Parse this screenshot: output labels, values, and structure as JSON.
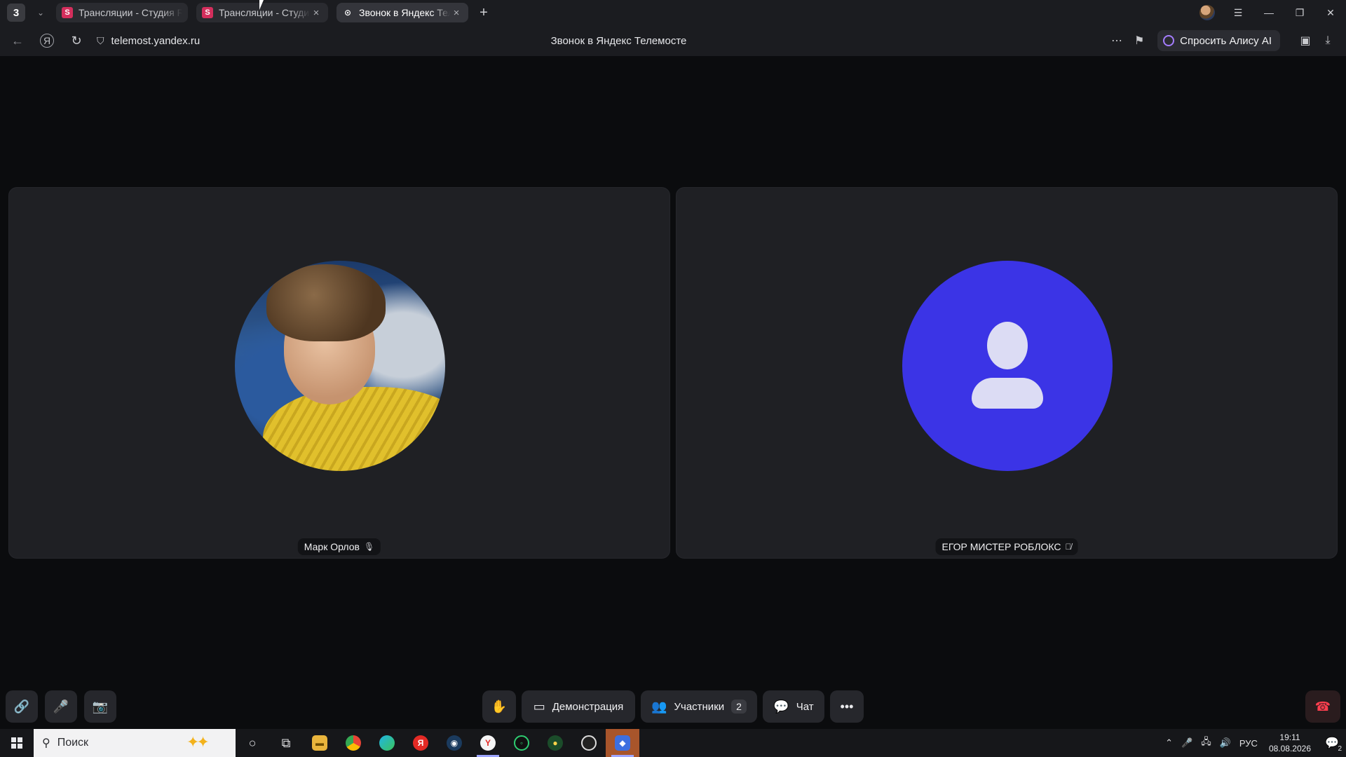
{
  "browser": {
    "tab_count": "3",
    "tabs": [
      {
        "title": "Трансляции - Студия RUTUBE",
        "favicon": "S",
        "state": "inactive"
      },
      {
        "title": "Трансляции - Студия RUTUBE",
        "favicon": "S",
        "state": "hovered"
      },
      {
        "title": "Звонок в Яндекс Телемосте",
        "favicon": "telemost-icon",
        "state": "active"
      }
    ],
    "url": "telemost.yandex.ru",
    "page_title": "Звонок в Яндекс Телемосте",
    "alice_button": "Спросить Алису AI"
  },
  "call": {
    "participants": [
      {
        "name": "Марк Орлов",
        "avatar": "photo",
        "mic": "on"
      },
      {
        "name": "ЕГОР МИСТЕР РОБЛОКС",
        "avatar": "placeholder",
        "mic": "muted",
        "avatar_color": "#3b34e6"
      }
    ],
    "controls": {
      "screenshare_label": "Демонстрация",
      "participants_label": "Участники",
      "participants_count": "2",
      "chat_label": "Чат"
    },
    "hangup_color": "#ff3f4f"
  },
  "taskbar": {
    "search_placeholder": "Поиск",
    "language": "РУС",
    "time": "19:11",
    "date": "08.08.2026",
    "notifications": "2"
  }
}
